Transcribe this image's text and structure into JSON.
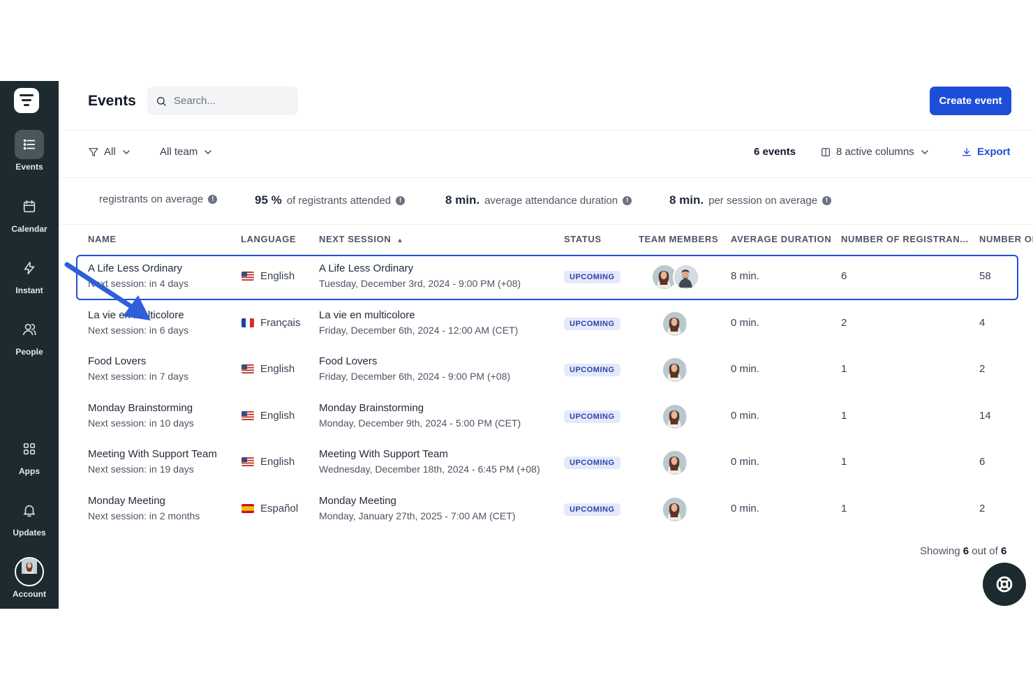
{
  "sidebar": {
    "items": [
      {
        "label": "Events",
        "icon": "list-icon",
        "active": true
      },
      {
        "label": "Calendar",
        "icon": "calendar-icon"
      },
      {
        "label": "Instant",
        "icon": "lightning-icon"
      },
      {
        "label": "People",
        "icon": "people-icon"
      },
      {
        "label": "Apps",
        "icon": "apps-grid-icon"
      },
      {
        "label": "Updates",
        "icon": "bell-icon"
      },
      {
        "label": "Account",
        "icon": "account-avatar"
      }
    ]
  },
  "header": {
    "title": "Events",
    "search_placeholder": "Search...",
    "create_label": "Create event"
  },
  "filters": {
    "type": "All",
    "team": "All team",
    "count": "6 events",
    "columns": "8 active columns",
    "export": "Export"
  },
  "stats": {
    "s1_label": "registrants on average",
    "s2_value": "95 %",
    "s2_label": "of registrants attended",
    "s3_value": "8 min.",
    "s3_label": "average attendance duration",
    "s4_value": "8 min.",
    "s4_label": "per session on average"
  },
  "table": {
    "headers": {
      "name": "NAME",
      "language": "LANGUAGE",
      "next_session": "NEXT SESSION",
      "status": "STATUS",
      "team": "TEAM MEMBERS",
      "duration": "AVERAGE DURATION",
      "registrants": "NUMBER OF REGISTRAN...",
      "number_of": "NUMBER OF"
    },
    "rows": [
      {
        "name": "A Life Less Ordinary",
        "sub": "Next session: in 4 days",
        "language": "English",
        "flag": "us",
        "session_title": "A Life Less Ordinary",
        "session_date": "Tuesday, December 3rd, 2024 - 9:00 PM (+08)",
        "status": "UPCOMING",
        "duration": "8 min.",
        "registrants": "6",
        "number_of": "58"
      },
      {
        "name": "La vie en multicolore",
        "sub": "Next session: in 6 days",
        "language": "Français",
        "flag": "fr",
        "session_title": "La vie en multicolore",
        "session_date": "Friday, December 6th, 2024 - 12:00 AM (CET)",
        "status": "UPCOMING",
        "duration": "0 min.",
        "registrants": "2",
        "number_of": "4"
      },
      {
        "name": "Food Lovers",
        "sub": "Next session: in 7 days",
        "language": "English",
        "flag": "us",
        "session_title": "Food Lovers",
        "session_date": "Friday, December 6th, 2024 - 9:00 PM (+08)",
        "status": "UPCOMING",
        "duration": "0 min.",
        "registrants": "1",
        "number_of": "2"
      },
      {
        "name": "Monday Brainstorming",
        "sub": "Next session: in 10 days",
        "language": "English",
        "flag": "us",
        "session_title": "Monday Brainstorming",
        "session_date": "Monday, December 9th, 2024 - 5:00 PM (CET)",
        "status": "UPCOMING",
        "duration": "0 min.",
        "registrants": "1",
        "number_of": "14"
      },
      {
        "name": "Meeting With Support Team",
        "sub": "Next session: in 19 days",
        "language": "English",
        "flag": "us",
        "session_title": "Meeting With Support Team",
        "session_date": "Wednesday, December 18th, 2024 - 6:45 PM (+08)",
        "status": "UPCOMING",
        "duration": "0 min.",
        "registrants": "1",
        "number_of": "6"
      },
      {
        "name": "Monday Meeting",
        "sub": "Next session: in 2 months",
        "language": "Español",
        "flag": "es",
        "session_title": "Monday Meeting",
        "session_date": "Monday, January 27th, 2025 - 7:00 AM (CET)",
        "status": "UPCOMING",
        "duration": "0 min.",
        "registrants": "1",
        "number_of": "2"
      }
    ]
  },
  "footer": {
    "showing": "Showing",
    "shown": "6",
    "out_of": "out of",
    "total": "6"
  },
  "colors": {
    "sidebar_bg": "#1d2a30",
    "accent": "#1d4ed8",
    "badge_bg": "#e4e9fb",
    "badge_text": "#3042a6"
  }
}
